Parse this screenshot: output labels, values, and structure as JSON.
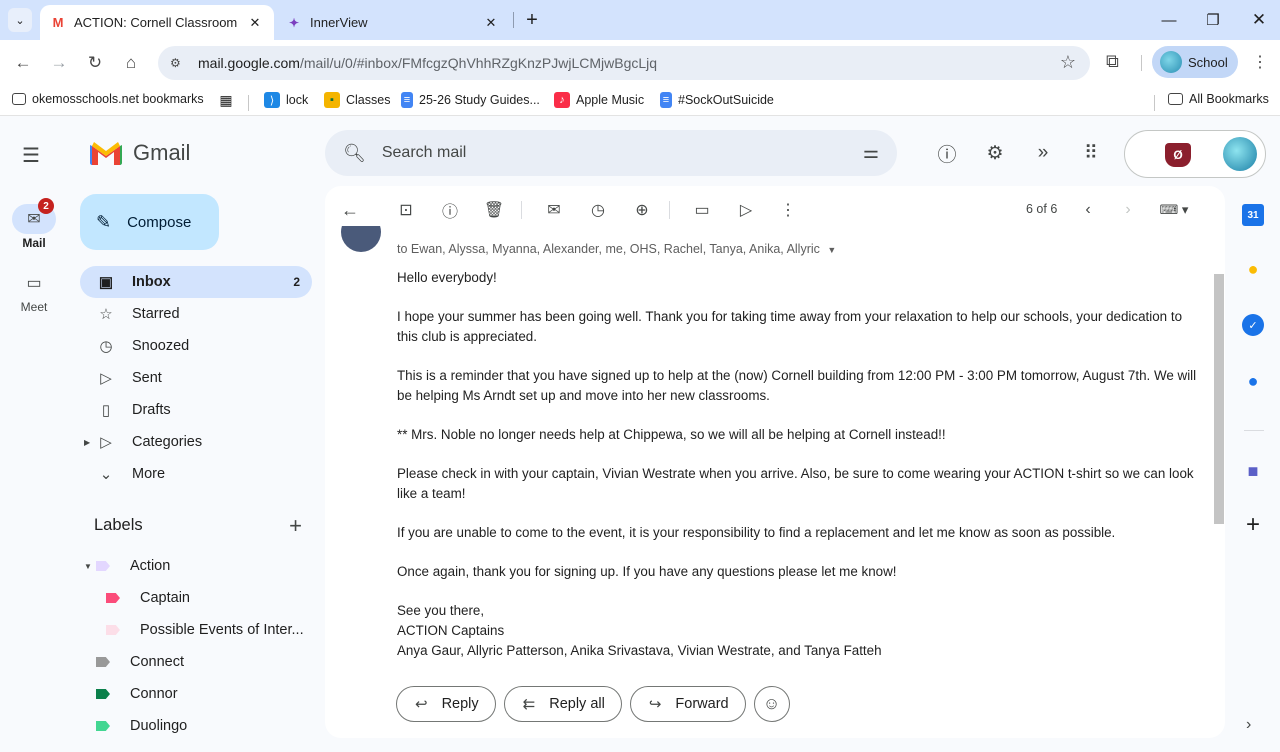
{
  "browser": {
    "tabs": [
      {
        "title": "ACTION: Cornell Classroom set",
        "icon": "gmail-icon",
        "active": true
      },
      {
        "title": "InnerView",
        "icon": "innerview-icon",
        "active": false
      }
    ],
    "url_host": "mail.google.com",
    "url_path": "/mail/u/0/#inbox/FMfcgzQhVhhRZgKnzPJwjLCMjwBgcLjq",
    "profile_label": "School",
    "bookmarks": [
      {
        "label": "okemosschools.net bookmarks",
        "icon": "bookmark-folder-icon"
      },
      {
        "label": "lock",
        "icon": "vscode-icon"
      },
      {
        "label": "Classes",
        "icon": "classroom-icon"
      },
      {
        "label": "25-26 Study Guides...",
        "icon": "docs-icon"
      },
      {
        "label": "Apple Music",
        "icon": "music-icon"
      },
      {
        "label": "#SockOutSuicide",
        "icon": "docs-icon"
      }
    ],
    "all_bookmarks": "All Bookmarks"
  },
  "gmail": {
    "logo_text": "Gmail",
    "rail": {
      "mail_label": "Mail",
      "mail_badge": "2",
      "meet_label": "Meet"
    },
    "search_placeholder": "Search mail",
    "compose_label": "Compose",
    "nav": [
      {
        "label": "Inbox",
        "icon": "inbox-icon",
        "count": "2",
        "active": true
      },
      {
        "label": "Starred",
        "icon": "star-icon",
        "count": ""
      },
      {
        "label": "Snoozed",
        "icon": "clock-icon",
        "count": ""
      },
      {
        "label": "Sent",
        "icon": "send-icon",
        "count": ""
      },
      {
        "label": "Drafts",
        "icon": "draft-icon",
        "count": ""
      },
      {
        "label": "Categories",
        "icon": "label-icon",
        "count": ""
      },
      {
        "label": "More",
        "icon": "chevron-down-icon",
        "count": ""
      }
    ],
    "labels_heading": "Labels",
    "labels": [
      {
        "label": "Action",
        "color": "#e3d7ff",
        "indent": 0,
        "caret": true
      },
      {
        "label": "Captain",
        "color": "#fb4c7a",
        "indent": 1,
        "caret": false
      },
      {
        "label": "Possible Events of Inter...",
        "color": "#fcdee8",
        "indent": 1,
        "caret": false
      },
      {
        "label": "Connect",
        "color": "#999999",
        "indent": 0,
        "caret": false
      },
      {
        "label": "Connor",
        "color": "#0b804b",
        "indent": 0,
        "caret": false
      },
      {
        "label": "Duolingo",
        "color": "#43d692",
        "indent": 0,
        "caret": false
      }
    ],
    "pager": "6 of 6",
    "message": {
      "recipients": "to Ewan, Alyssa, Myanna, Alexander, me, OHS, Rachel, Tanya, Anika, Allyric",
      "paragraphs": [
        "Hello everybody!",
        "I hope your summer has been going well. Thank you for taking time away from your relaxation to help our schools, your dedication to this club is appreciated.",
        "This is a reminder that you have signed up to help at the (now) Cornell building from 12:00 PM - 3:00 PM tomorrow, August 7th. We will be helping Ms Arndt set up and move into her new classrooms.",
        "** Mrs. Noble no longer needs help at Chippewa, so we will all be helping at Cornell instead!!",
        "Please check in with your captain, Vivian Westrate when you arrive. Also, be sure to come wearing your ACTION t-shirt so we can look like a team!",
        "If you are unable to come to the event, it is your responsibility to find a replacement and let me know as soon as possible.",
        "Once again, thank you for signing up. If you have any questions please let me know!"
      ],
      "signoff": "See you there,",
      "signature_1": "ACTION Captains",
      "signature_2": "Anya Gaur, Allyric Patterson, Anika Srivastava, Vivian Westrate, and Tanya Fatteh"
    },
    "actions": {
      "reply": "Reply",
      "reply_all": "Reply all",
      "forward": "Forward"
    },
    "side_panel": {
      "calendar_day": "31"
    }
  }
}
